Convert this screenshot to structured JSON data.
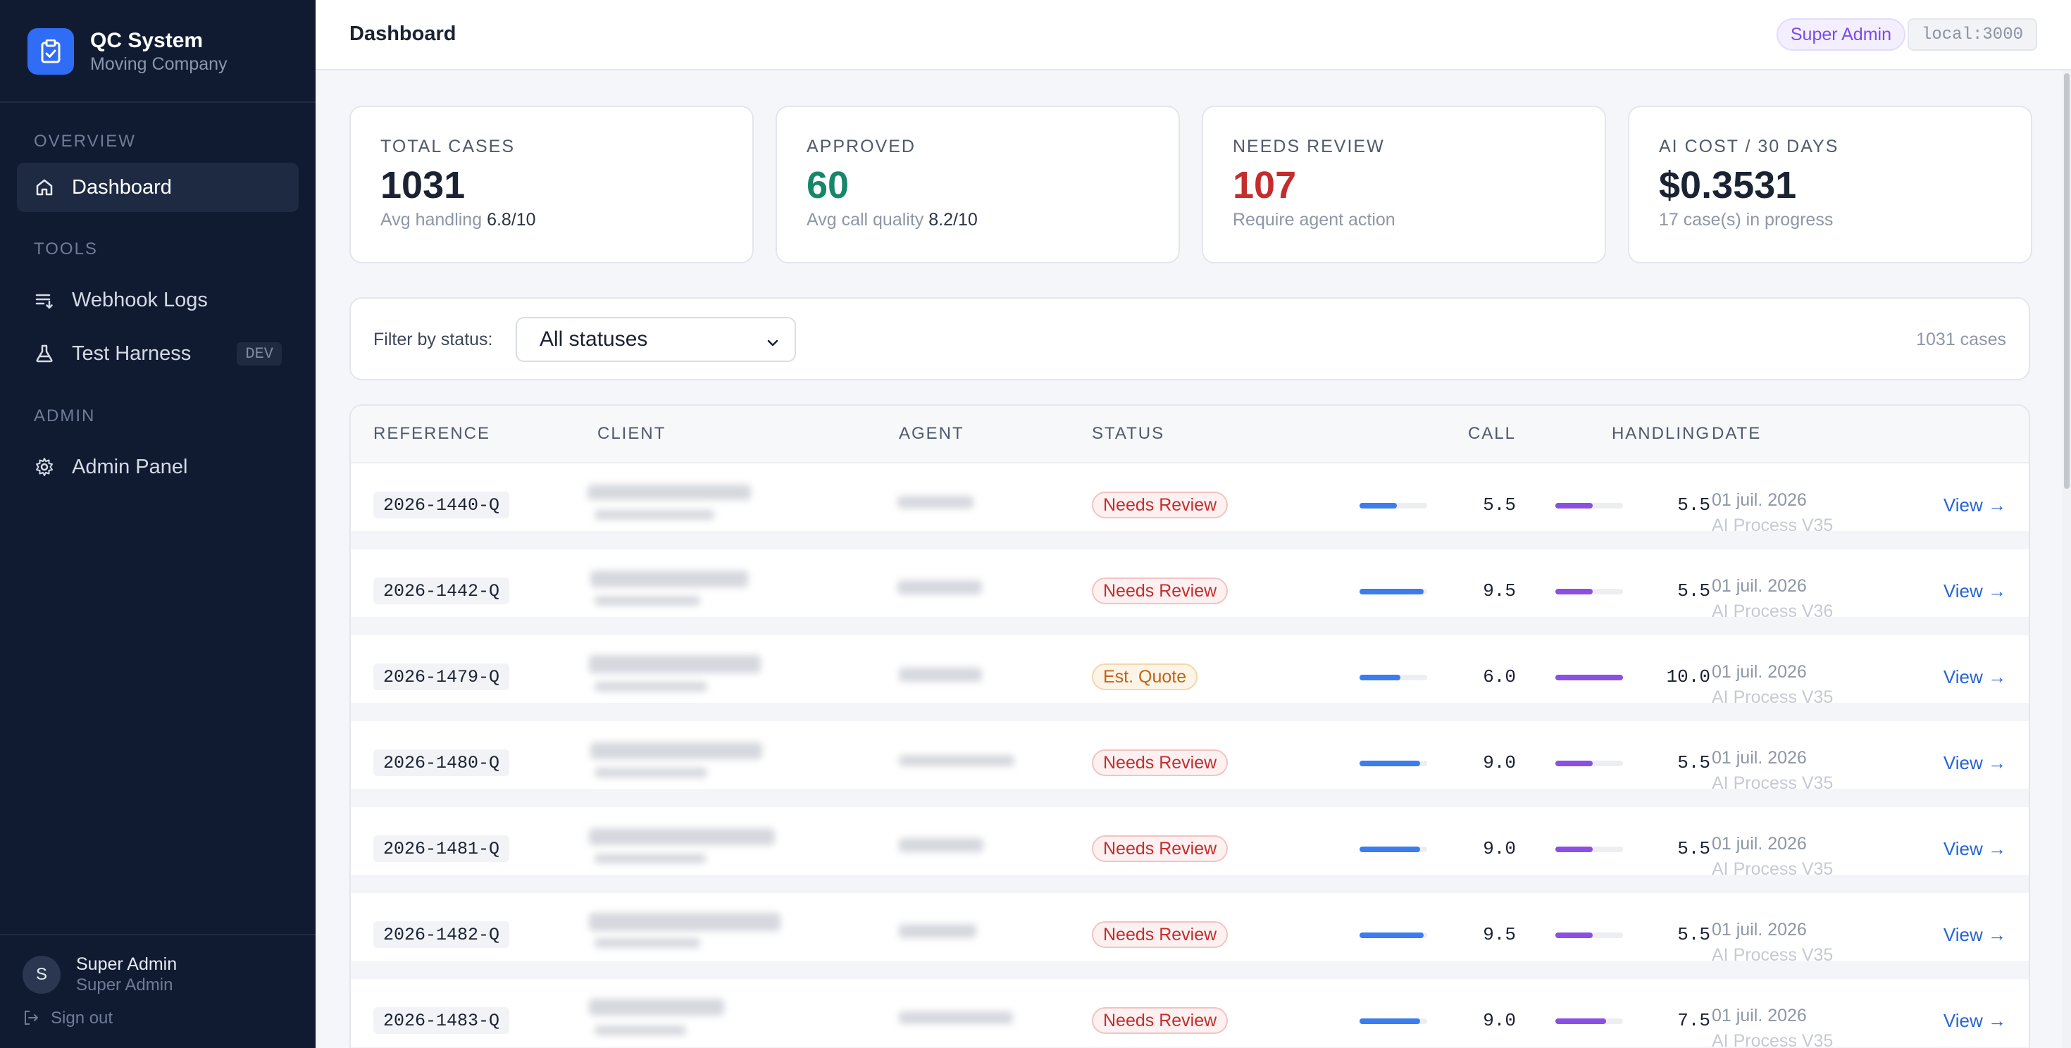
{
  "brand": {
    "title": "QC System",
    "subtitle": "Moving Company"
  },
  "sidebar": {
    "sections": [
      {
        "label": "Overview",
        "items": [
          {
            "label": "Dashboard",
            "icon": "home-icon",
            "active": true
          }
        ]
      },
      {
        "label": "Tools",
        "items": [
          {
            "label": "Webhook Logs",
            "icon": "list-icon"
          },
          {
            "label": "Test Harness",
            "icon": "flask-icon",
            "badge": "DEV"
          }
        ]
      },
      {
        "label": "Admin",
        "items": [
          {
            "label": "Admin Panel",
            "icon": "gear-icon"
          }
        ]
      }
    ],
    "user": {
      "initial": "S",
      "name": "Super Admin",
      "role": "Super Admin"
    },
    "signout_label": "Sign out"
  },
  "header": {
    "title": "Dashboard",
    "role_badge": "Super Admin",
    "host": "local:3000"
  },
  "stats": [
    {
      "label": "Total Cases",
      "value": "1031",
      "sub_prefix": "Avg handling",
      "sub_value": "6.8/10",
      "color": "#1a2233"
    },
    {
      "label": "Approved",
      "value": "60",
      "sub_prefix": "Avg call quality",
      "sub_value": "8.2/10",
      "color": "#17876a"
    },
    {
      "label": "Needs Review",
      "value": "107",
      "sub_prefix": "Require agent action",
      "sub_value": "",
      "color": "#c42d2d"
    },
    {
      "label": "AI Cost / 30 Days",
      "value": "$0.3531",
      "sub_prefix": "17 case(s) in progress",
      "sub_value": "",
      "color": "#1a2233"
    }
  ],
  "filter": {
    "label": "Filter by status:",
    "selected": "All statuses",
    "count": "1031 cases"
  },
  "table": {
    "columns": [
      "Reference",
      "Client",
      "Agent",
      "Status",
      "Call",
      "Handling",
      "Date"
    ],
    "rows": [
      {
        "reference": "2026-1440-Q",
        "status": "Needs Review",
        "status_kind": "review",
        "call": "5.5",
        "call_value": 5.5,
        "handling": "5.5",
        "handling_value": 5.5,
        "date": "01 juil. 2026",
        "process": "AI Process V35",
        "action": "View →"
      },
      {
        "reference": "2026-1442-Q",
        "status": "Needs Review",
        "status_kind": "review",
        "call": "9.5",
        "call_value": 9.5,
        "handling": "5.5",
        "handling_value": 5.5,
        "date": "01 juil. 2026",
        "process": "AI Process V36",
        "action": "View →"
      },
      {
        "reference": "2026-1479-Q",
        "status": "Est. Quote",
        "status_kind": "quote",
        "call": "6.0",
        "call_value": 6.0,
        "handling": "10.0",
        "handling_value": 10.0,
        "date": "01 juil. 2026",
        "process": "AI Process V35",
        "action": "View →"
      },
      {
        "reference": "2026-1480-Q",
        "status": "Needs Review",
        "status_kind": "review",
        "call": "9.0",
        "call_value": 9.0,
        "handling": "5.5",
        "handling_value": 5.5,
        "date": "01 juil. 2026",
        "process": "AI Process V35",
        "action": "View →"
      },
      {
        "reference": "2026-1481-Q",
        "status": "Needs Review",
        "status_kind": "review",
        "call": "9.0",
        "call_value": 9.0,
        "handling": "5.5",
        "handling_value": 5.5,
        "date": "01 juil. 2026",
        "process": "AI Process V35",
        "action": "View →"
      },
      {
        "reference": "2026-1482-Q",
        "status": "Needs Review",
        "status_kind": "review",
        "call": "9.5",
        "call_value": 9.5,
        "handling": "5.5",
        "handling_value": 5.5,
        "date": "01 juil. 2026",
        "process": "AI Process V35",
        "action": "View →"
      },
      {
        "reference": "2026-1483-Q",
        "status": "Needs Review",
        "status_kind": "review",
        "call": "9.0",
        "call_value": 9.0,
        "handling": "7.5",
        "handling_value": 7.5,
        "date": "01 juil. 2026",
        "process": "AI Process V35",
        "action": "View →"
      }
    ]
  },
  "colors": {
    "call_bar": "#3b7cf0",
    "handling_bar": "#8b4fe3",
    "accent": "#2f6df6"
  }
}
